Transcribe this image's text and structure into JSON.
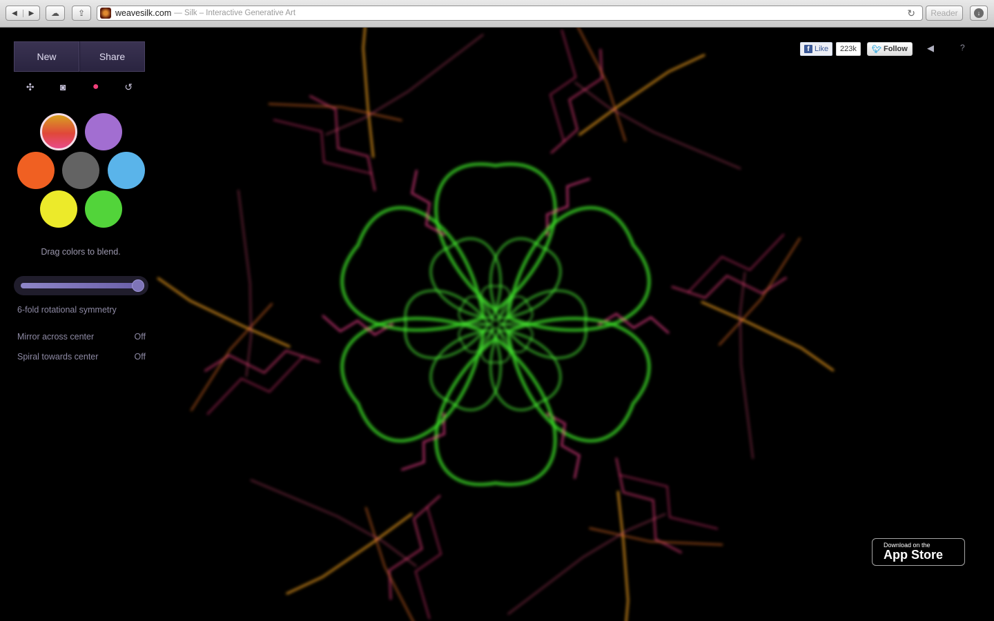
{
  "browser": {
    "url_host": "weavesilk.com",
    "url_title": "— Silk – Interactive Generative Art",
    "reader_label": "Reader"
  },
  "panel": {
    "new_label": "New",
    "share_label": "Share",
    "icons": [
      "fullscreen-icon",
      "camera-icon",
      "record-icon",
      "undo-icon"
    ],
    "colors": [
      "#e84a88",
      "#a26ed1",
      "#f06022",
      "#636363",
      "#5ab4ea",
      "#ecea2a",
      "#52d43a"
    ],
    "hint": "Drag colors to blend.",
    "symmetry_slider_value": 1.0,
    "symmetry_label": "6-fold rotational symmetry",
    "mirror_label": "Mirror across center",
    "mirror_value": "Off",
    "spiral_label": "Spiral towards center",
    "spiral_value": "Off"
  },
  "social": {
    "fb_like_label": "Like",
    "fb_count": "223k",
    "twitter_label": "Follow"
  },
  "appstore": {
    "small": "Download on the",
    "big": "App Store"
  }
}
